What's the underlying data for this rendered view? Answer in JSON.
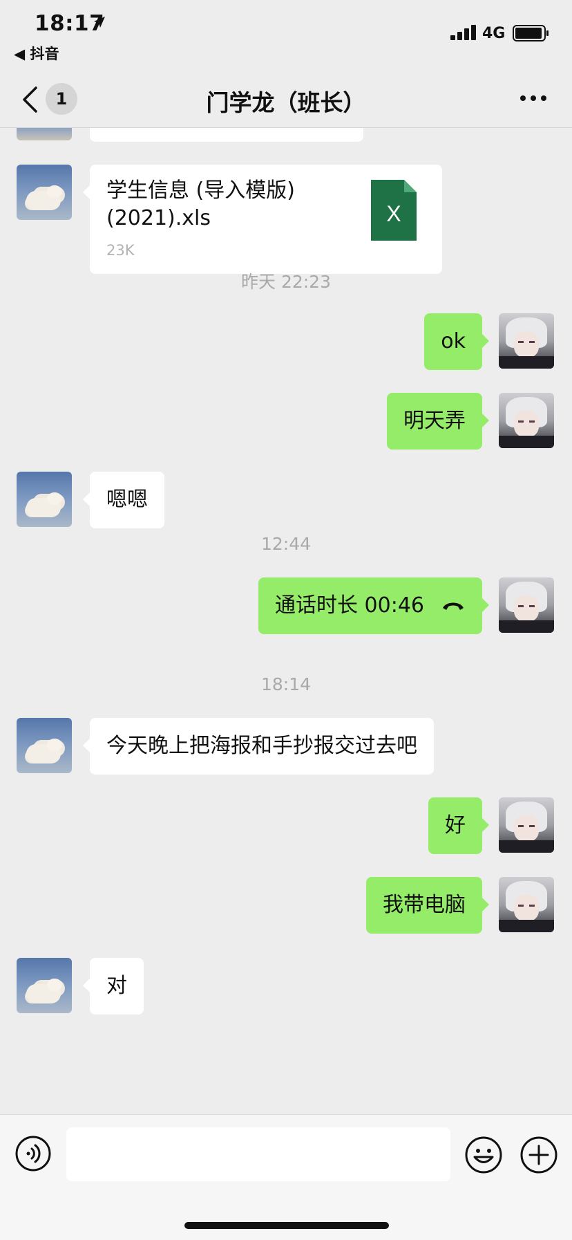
{
  "status_bar": {
    "time": "18:17",
    "back_app": "◀ 抖音",
    "network": "4G"
  },
  "nav": {
    "unread_count": "1",
    "title": "门学龙（班长）"
  },
  "messages": [
    {
      "type": "file",
      "sender": "other",
      "file_name": "学生信息 (导入模版)\n(2021).xls",
      "file_size": "23K",
      "file_icon_letter": "X"
    },
    {
      "type": "time",
      "text": "昨天 22:23"
    },
    {
      "type": "text",
      "sender": "me",
      "text": "ok"
    },
    {
      "type": "text",
      "sender": "me",
      "text": "明天弄"
    },
    {
      "type": "text",
      "sender": "other",
      "text": "嗯嗯"
    },
    {
      "type": "time",
      "text": "12:44"
    },
    {
      "type": "call",
      "sender": "me",
      "text": "通话时长 00:46"
    },
    {
      "type": "time",
      "text": "18:14"
    },
    {
      "type": "text",
      "sender": "other",
      "text": "今天晚上把海报和手抄报交过去吧"
    },
    {
      "type": "text",
      "sender": "me",
      "text": "好"
    },
    {
      "type": "text",
      "sender": "me",
      "text": "我带电脑"
    },
    {
      "type": "text",
      "sender": "other",
      "text": "对"
    }
  ],
  "input": {
    "placeholder": ""
  },
  "colors": {
    "bubble_out": "#95ec69",
    "bubble_in": "#ffffff",
    "background": "#ededed",
    "xls_green": "#1f7246"
  }
}
